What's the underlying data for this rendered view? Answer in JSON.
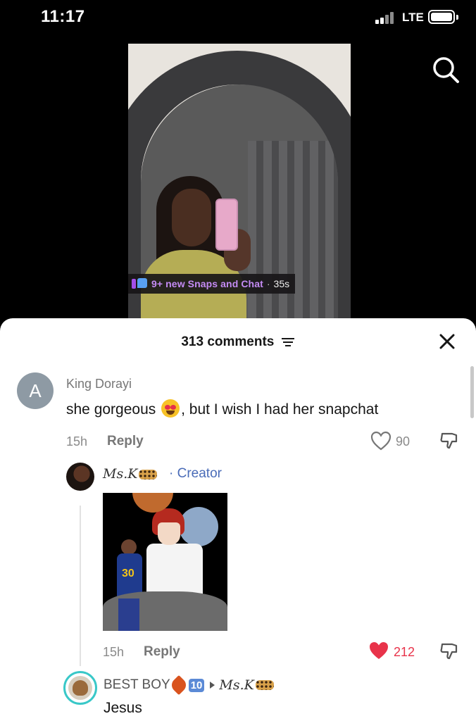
{
  "status_bar": {
    "time": "11:17",
    "network": "LTE"
  },
  "video": {
    "overlay_text": "9+ new Snaps and Chat",
    "overlay_separator": "·",
    "overlay_time": "35s"
  },
  "comments_sheet": {
    "count_label": "313 comments"
  },
  "comments": [
    {
      "avatar_letter": "A",
      "username": "King Dorayi",
      "text_before_emoji": "she gorgeous",
      "text_after_emoji": ", but I wish I had her snapchat",
      "time": "15h",
      "reply_label": "Reply",
      "likes": "90",
      "liked": false
    }
  ],
  "creator_reply": {
    "name": "Ms.K",
    "tag": "· Creator",
    "time": "15h",
    "reply_label": "Reply",
    "likes": "212",
    "liked": true,
    "like_color": "#e8334a"
  },
  "nested_reply": {
    "name": "BEST BOY",
    "badge": "10",
    "reply_to": "Ms.K",
    "text": "Jesus"
  },
  "colors": {
    "creator_tag": "#4a6cb8",
    "avatar_ring": "#39c8c8",
    "snap_text": "#c48bf4"
  },
  "icons": [
    "search-icon",
    "close-icon",
    "filter-icon",
    "heart-icon",
    "dislike-icon",
    "heart-filled-icon"
  ]
}
